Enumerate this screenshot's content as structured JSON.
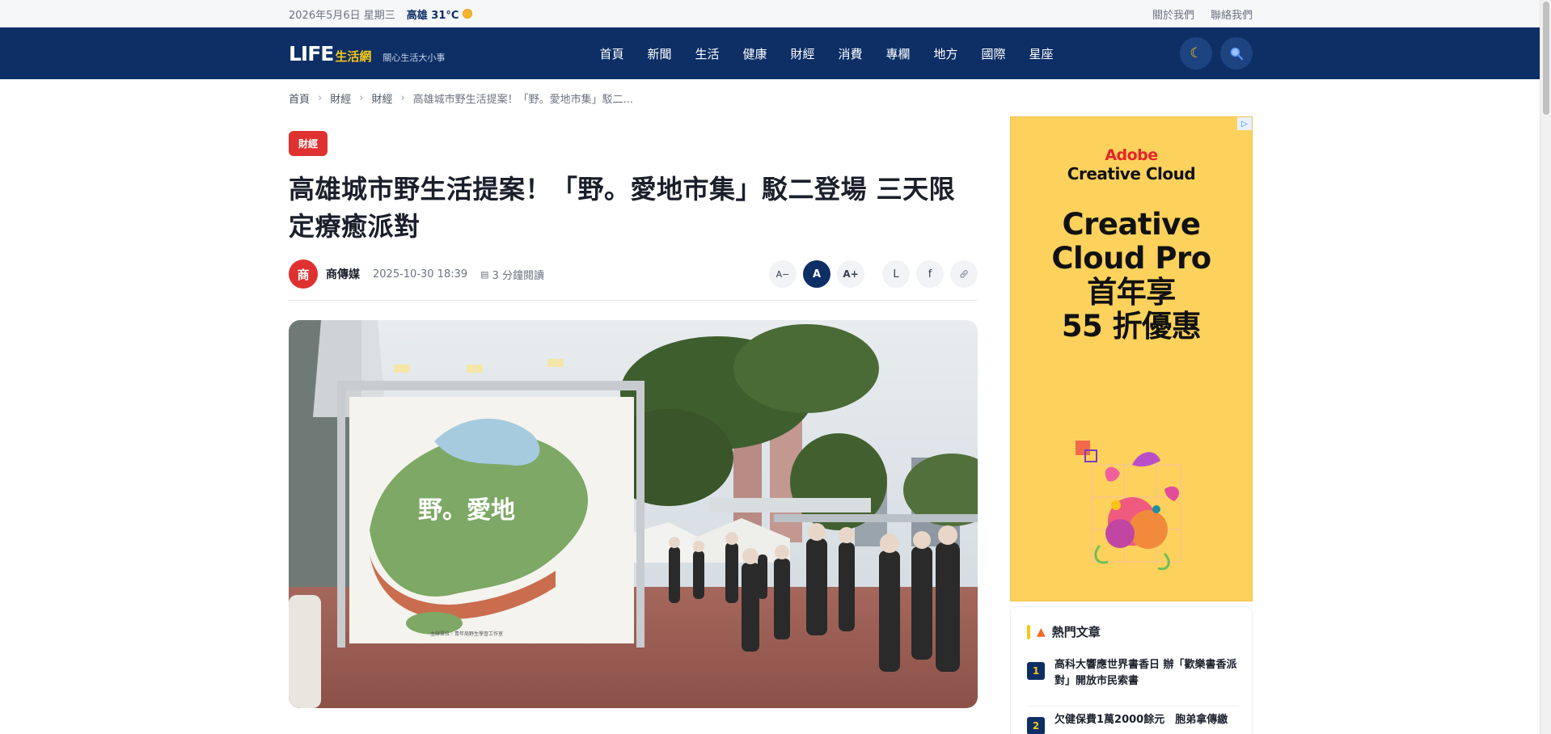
{
  "topbar": {
    "date": "2026年5月6日 星期三",
    "weather": "高雄 31°C",
    "about": "關於我們",
    "contact": "聯絡我們"
  },
  "header": {
    "logo_main": "LIFE",
    "logo_sub": "生活網",
    "slogan": "關心生活大小事",
    "nav": [
      "首頁",
      "新聞",
      "生活",
      "健康",
      "財經",
      "消費",
      "專欄",
      "地方",
      "國際",
      "星座"
    ],
    "darkmode_icon": "moon-icon",
    "search_icon": "search-icon"
  },
  "breadcrumb": {
    "items": [
      "首頁",
      "財經",
      "財經"
    ],
    "separator": "›",
    "current": "高雄城市野生活提案！「野。愛地市集」駁二..."
  },
  "article": {
    "category": "財經",
    "title": "高雄城市野生活提案！「野。愛地市集」駁二登場 三天限定療癒派對",
    "avatar_text": "商",
    "author": "商傳媒",
    "datetime": "2025-10-30 18:39",
    "read_icon": "book-icon",
    "read_time": "3 分鐘閱讀",
    "font_buttons": [
      "A−",
      "A",
      "A+"
    ],
    "share_buttons": [
      "L",
      "f"
    ],
    "link_icon": "link-icon",
    "hero": {
      "board_title": "野。愛地",
      "board_footer": "主辦單位｜青年局野生學習工作室"
    }
  },
  "ad": {
    "adchoices": "▷",
    "brand_line1": "Adobe",
    "brand_line2": "Creative Cloud",
    "headline": [
      "Creative",
      "Cloud Pro",
      "首年享",
      "55 折優惠"
    ]
  },
  "hot": {
    "title": "熱門文章",
    "fire_icon": "fire-icon",
    "items": [
      {
        "rank": "1",
        "text": "高科大響應世界書香日 辦「歡樂書香派對」開放市民索書"
      },
      {
        "rank": "2",
        "text": "欠健保費1萬2000餘元　胞弟拿傳繳"
      }
    ]
  },
  "colors": {
    "brand_navy": "#0d2f66",
    "accent_yellow": "#f5c518",
    "category_red": "#e03131",
    "ad_yellow": "#fcd25c"
  }
}
